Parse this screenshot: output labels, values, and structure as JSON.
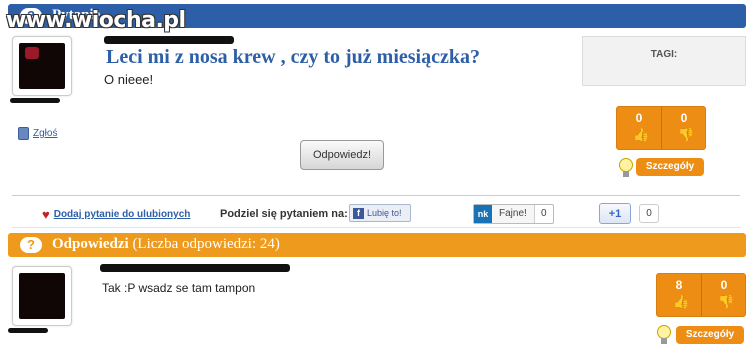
{
  "watermark": "www.wiocha.pl",
  "question_header": {
    "title": "Pytanie"
  },
  "question": {
    "title": "Leci mi z nosa krew , czy to już miesiączka?",
    "body": "O nieee!",
    "report_label": "Zgłoś",
    "reply_button": "Odpowiedz!",
    "votes_up": "0",
    "votes_down": "0",
    "details_button": "Szczegóły"
  },
  "tags": {
    "label": "TAGI:"
  },
  "share": {
    "favorite_label": "Dodaj pytanie do ulubionych",
    "share_label": "Podziel się pytaniem na:",
    "fb_label": "Lubię to!",
    "nk_logo": "nk",
    "nk_label": "Fajne!",
    "nk_count": "0",
    "gplus_label": "+1",
    "gplus_count": "0"
  },
  "answers_header": {
    "title": "Odpowiedzi",
    "count_text": "(Liczba odpowiedzi: 24)"
  },
  "answer": {
    "body": "Tak :P wsadz se tam tampon",
    "votes_up": "8",
    "votes_down": "0",
    "details_button": "Szczegóły"
  },
  "icons": {
    "question": "question-bubble-icon",
    "trash": "trash-icon",
    "thumb_up": "thumb-up-icon",
    "thumb_down": "thumb-down-icon",
    "bulb": "lightbulb-icon",
    "heart": "heart-icon"
  },
  "colors": {
    "blue": "#2d5fa8",
    "orange": "#ee9a1c"
  }
}
